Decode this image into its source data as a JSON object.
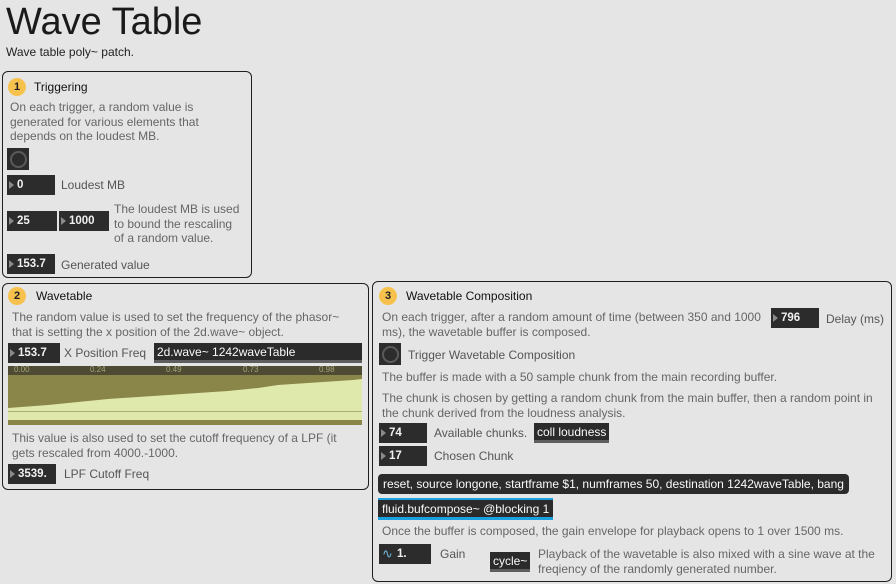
{
  "header": {
    "title": "Wave Table",
    "subtitle": "Wave table poly~ patch."
  },
  "colors": {
    "badge": "#f7c14e",
    "object_bg": "#2b2b2b",
    "wave_fill": "#dfe9ac",
    "wave_dark": "#8a8549",
    "accent": "#1ba0e0"
  },
  "panel1": {
    "badge": "1",
    "title": "Triggering",
    "description": "On each trigger, a random value is generated for various elements that depends on the loudest MB.",
    "loudest_value": "0",
    "loudest_label": "Loudest MB",
    "min_value": "25",
    "max_value": "1000",
    "bound_text": "The loudest MB is used to bound the rescaling of a random value.",
    "generated_value": "153.7",
    "generated_label": "Generated value"
  },
  "panel2": {
    "badge": "2",
    "title": "Wavetable",
    "description": "The random value is used to set the frequency of the phasor~ that is setting the x position of the 2d.wave~ object.",
    "freq_value": "153.7",
    "freq_label": "X Position Freq",
    "wave_object": "2d.wave~ 1242waveTable",
    "ruler_ticks": [
      "0.00",
      "0.24",
      "0.49",
      "0.73",
      "0.98"
    ],
    "lpf_text": "This value is also used to set the cutoff frequency of a LPF (it gets rescaled from 4000.-1000.",
    "lpf_value": "3539.",
    "lpf_label": "LPF Cutoff Freq"
  },
  "panel3": {
    "badge": "3",
    "title": "Wavetable Composition",
    "description": "On each trigger, after a random amount of time (between 350 and 1000 ms), the wavetable buffer is composed.",
    "delay_value": "796",
    "delay_label": "Delay (ms)",
    "trigger_label": "Trigger Wavetable Composition",
    "buffer_text": "The buffer is made with a 50 sample chunk from the main recording buffer.",
    "chunk_text": "The chunk is chosen by getting a random chunk from the main buffer, then a random point in the chunk derived from the loudness analysis.",
    "available_value": "74",
    "available_label": "Available chunks.",
    "coll_object": "coll loudness",
    "chosen_value": "17",
    "chosen_label": "Chosen Chunk",
    "message": "reset, source longone, startframe $1, numframes 50, destination 1242waveTable, bang",
    "compose_object": "fluid.bufcompose~ @blocking 1",
    "gain_text": "Once the buffer is composed, the gain envelope for playback opens to 1 over 1500 ms.",
    "gain_value": "1.",
    "gain_label": "Gain",
    "cycle_object": "cycle~",
    "cycle_text": "Playback of the wavetable is also mixed with a sine wave at the freqiency of the randomly generated number."
  }
}
